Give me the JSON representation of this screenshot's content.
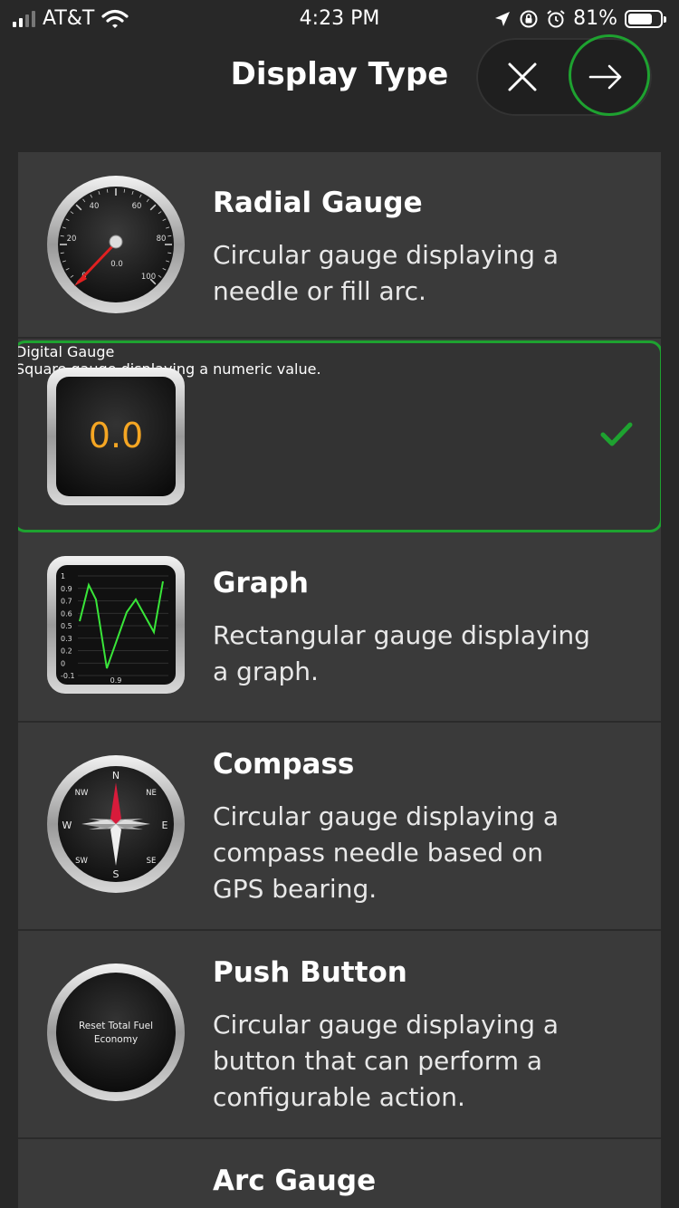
{
  "status_bar": {
    "carrier": "AT&T",
    "time": "4:23 PM",
    "battery": "81%"
  },
  "header": {
    "title": "Display Type",
    "close_icon": "close-icon",
    "next_icon": "arrow-right-icon"
  },
  "items": [
    {
      "name": "Radial Gauge",
      "desc": "Circular gauge displaying a needle or fill arc.",
      "selected": false,
      "thumb": {
        "ticks": [
          "20",
          "40",
          "60",
          "80",
          "100",
          "0"
        ],
        "value": "0.0"
      }
    },
    {
      "name": "Digital Gauge",
      "desc": "Square gauge displaying a numeric value.",
      "selected": true,
      "thumb": {
        "value": "0.0"
      }
    },
    {
      "name": "Graph",
      "desc": "Rectangular gauge displaying a graph.",
      "selected": false,
      "thumb": {
        "ylabels": [
          "1",
          "0.9",
          "0.7",
          "0.6",
          "0.5",
          "0.3",
          "0.2",
          "0",
          "-0.1"
        ],
        "xlabel": "0.9"
      }
    },
    {
      "name": "Compass",
      "desc": "Circular gauge displaying a compass needle based on GPS bearing.",
      "selected": false,
      "thumb": {
        "n": "N",
        "ne": "NE",
        "e": "E",
        "se": "SE",
        "s": "S",
        "sw": "SW",
        "w": "W",
        "nw": "NW"
      }
    },
    {
      "name": "Push Button",
      "desc": "Circular gauge displaying a button that can perform a configurable action.",
      "selected": false,
      "thumb": {
        "label": "Reset Total Fuel Economy"
      }
    },
    {
      "name": "Arc Gauge",
      "desc": "",
      "selected": false
    }
  ],
  "colors": {
    "accent_green": "#1ea230",
    "digital_value": "#f5a623",
    "needle": "#e02020",
    "graph_line": "#39e639"
  }
}
